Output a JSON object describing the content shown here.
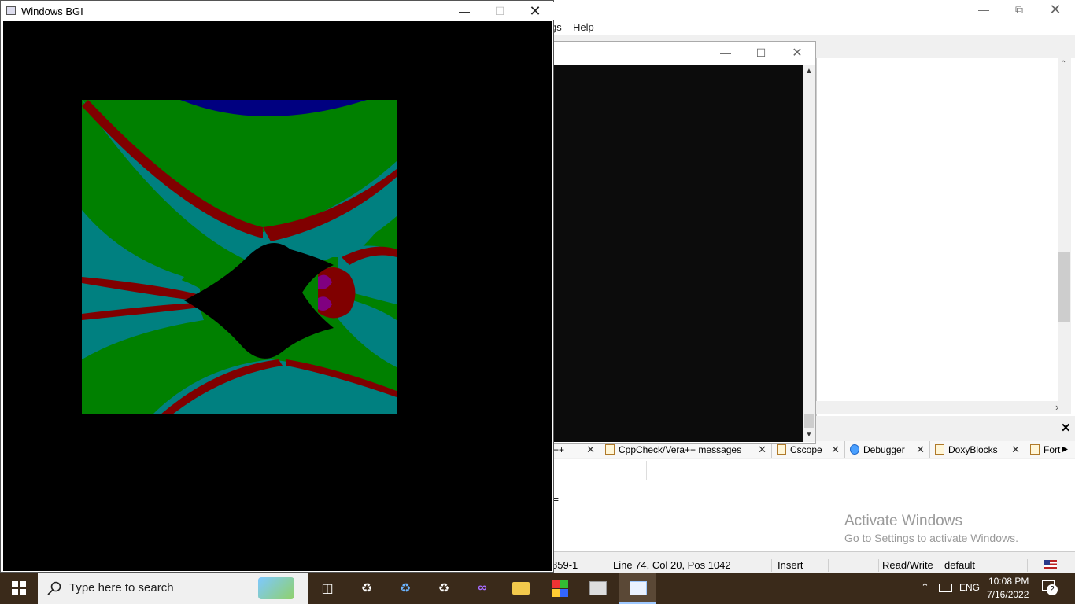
{
  "bgi_window": {
    "title": "Windows BGI"
  },
  "ide": {
    "menu": {
      "partial": "gs",
      "help": "Help"
    },
    "log_tabs": [
      {
        "label": "++"
      },
      {
        "label": "CppCheck/Vera++ messages"
      },
      {
        "label": "Cscope"
      },
      {
        "label": "Debugger"
      },
      {
        "label": "DoxyBlocks"
      },
      {
        "label": "Fort"
      }
    ],
    "status": {
      "encoding": "859-1",
      "position": "Line 74, Col 20, Pos 1042",
      "mode": "Insert",
      "access": "Read/Write",
      "profile": "default"
    }
  },
  "watermark": {
    "title": "Activate Windows",
    "subtitle": "Go to Settings to activate Windows."
  },
  "taskbar": {
    "search_placeholder": "Type here to search",
    "language": "ENG",
    "time": "10:08 PM",
    "date": "7/16/2022",
    "notification_count": "2"
  },
  "colors": {
    "fractal_green": "#008000",
    "fractal_teal": "#008080",
    "fractal_red": "#800000",
    "fractal_blue": "#000080",
    "fractal_black": "#000000"
  }
}
